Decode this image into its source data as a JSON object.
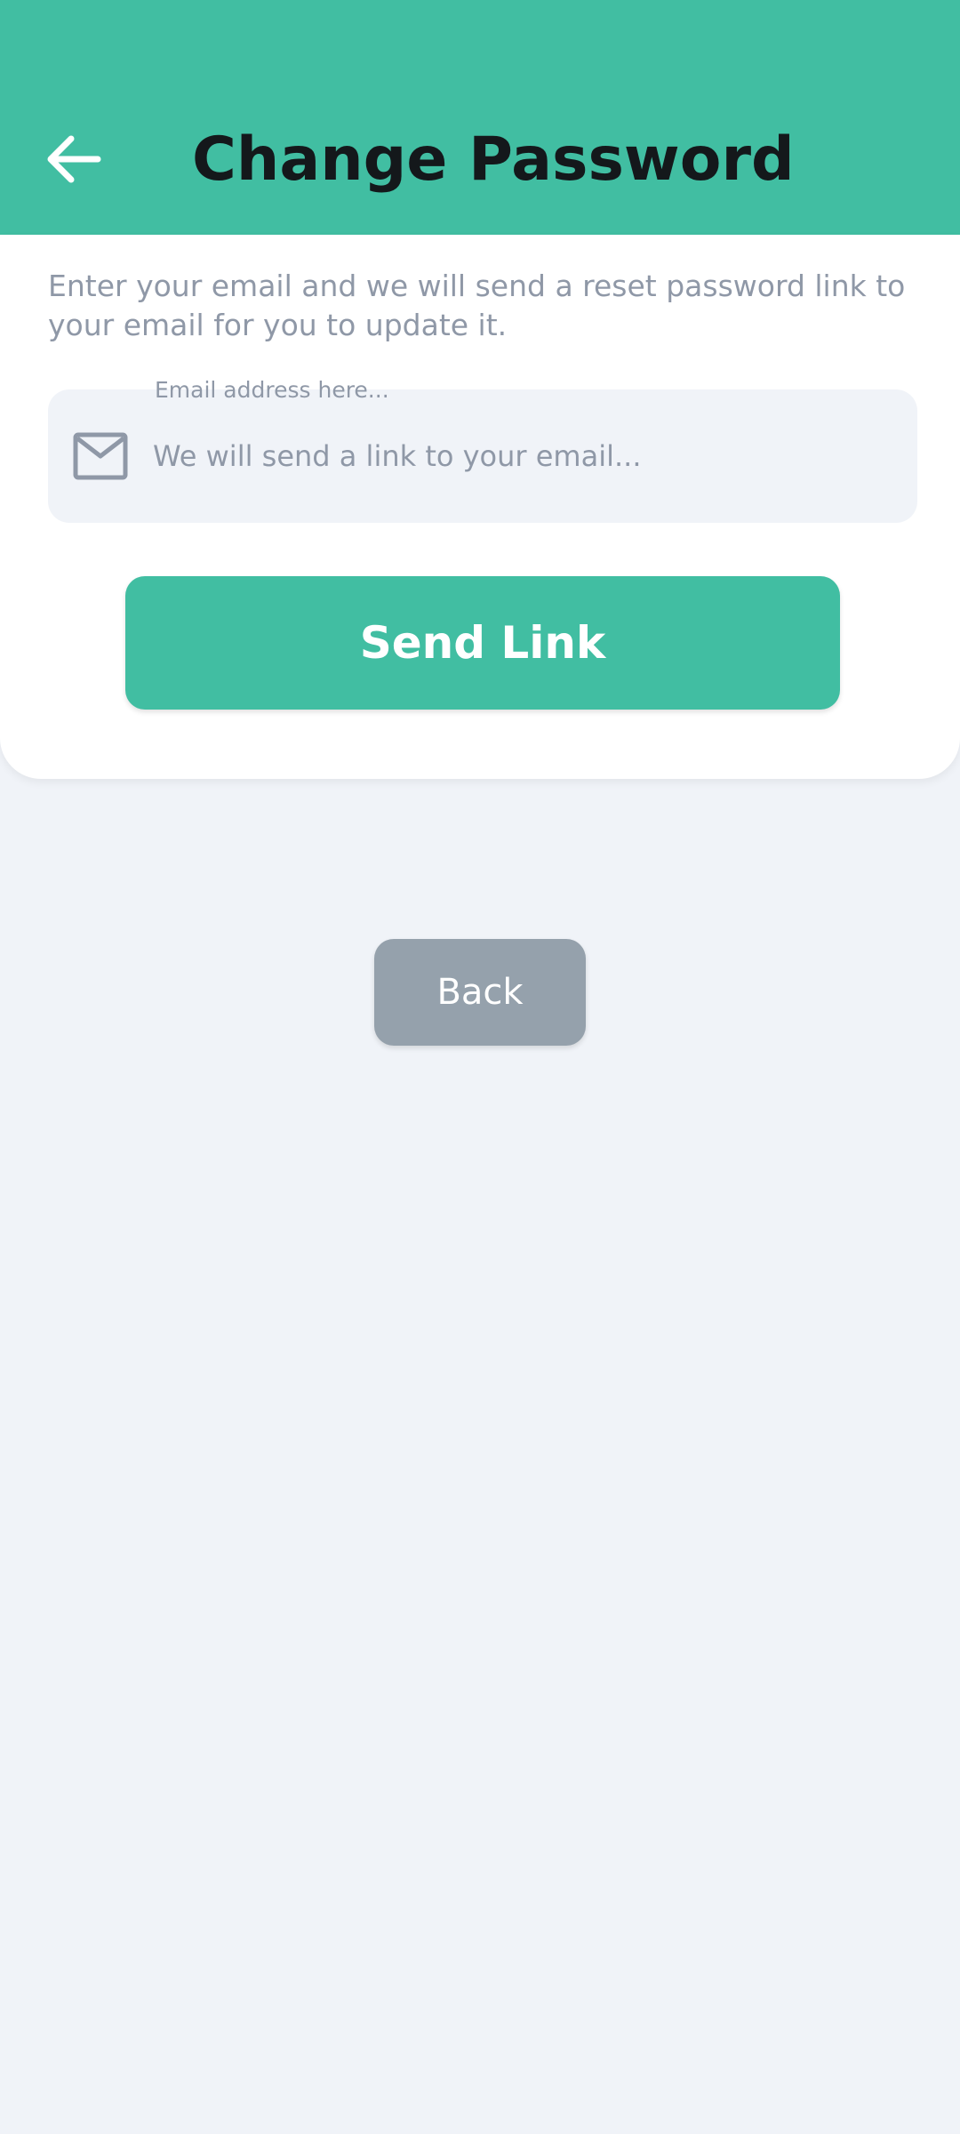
{
  "header": {
    "title": "Change Password",
    "back_icon": "arrow-left-icon",
    "background_color": "#41bea2"
  },
  "form": {
    "description": "Enter your email and we will send a reset password link to your email for you to update it.",
    "email": {
      "label": "Email address here...",
      "placeholder": "We will send a link to your email...",
      "value": "",
      "icon": "mail-icon"
    },
    "send_button_label": "Send Link"
  },
  "footer": {
    "back_button_label": "Back"
  },
  "colors": {
    "accent": "#41bea2",
    "secondary_button": "#95a1ac",
    "text_primary": "#14181b",
    "text_secondary": "#8f98a7",
    "page_background": "#f0f3f8"
  }
}
